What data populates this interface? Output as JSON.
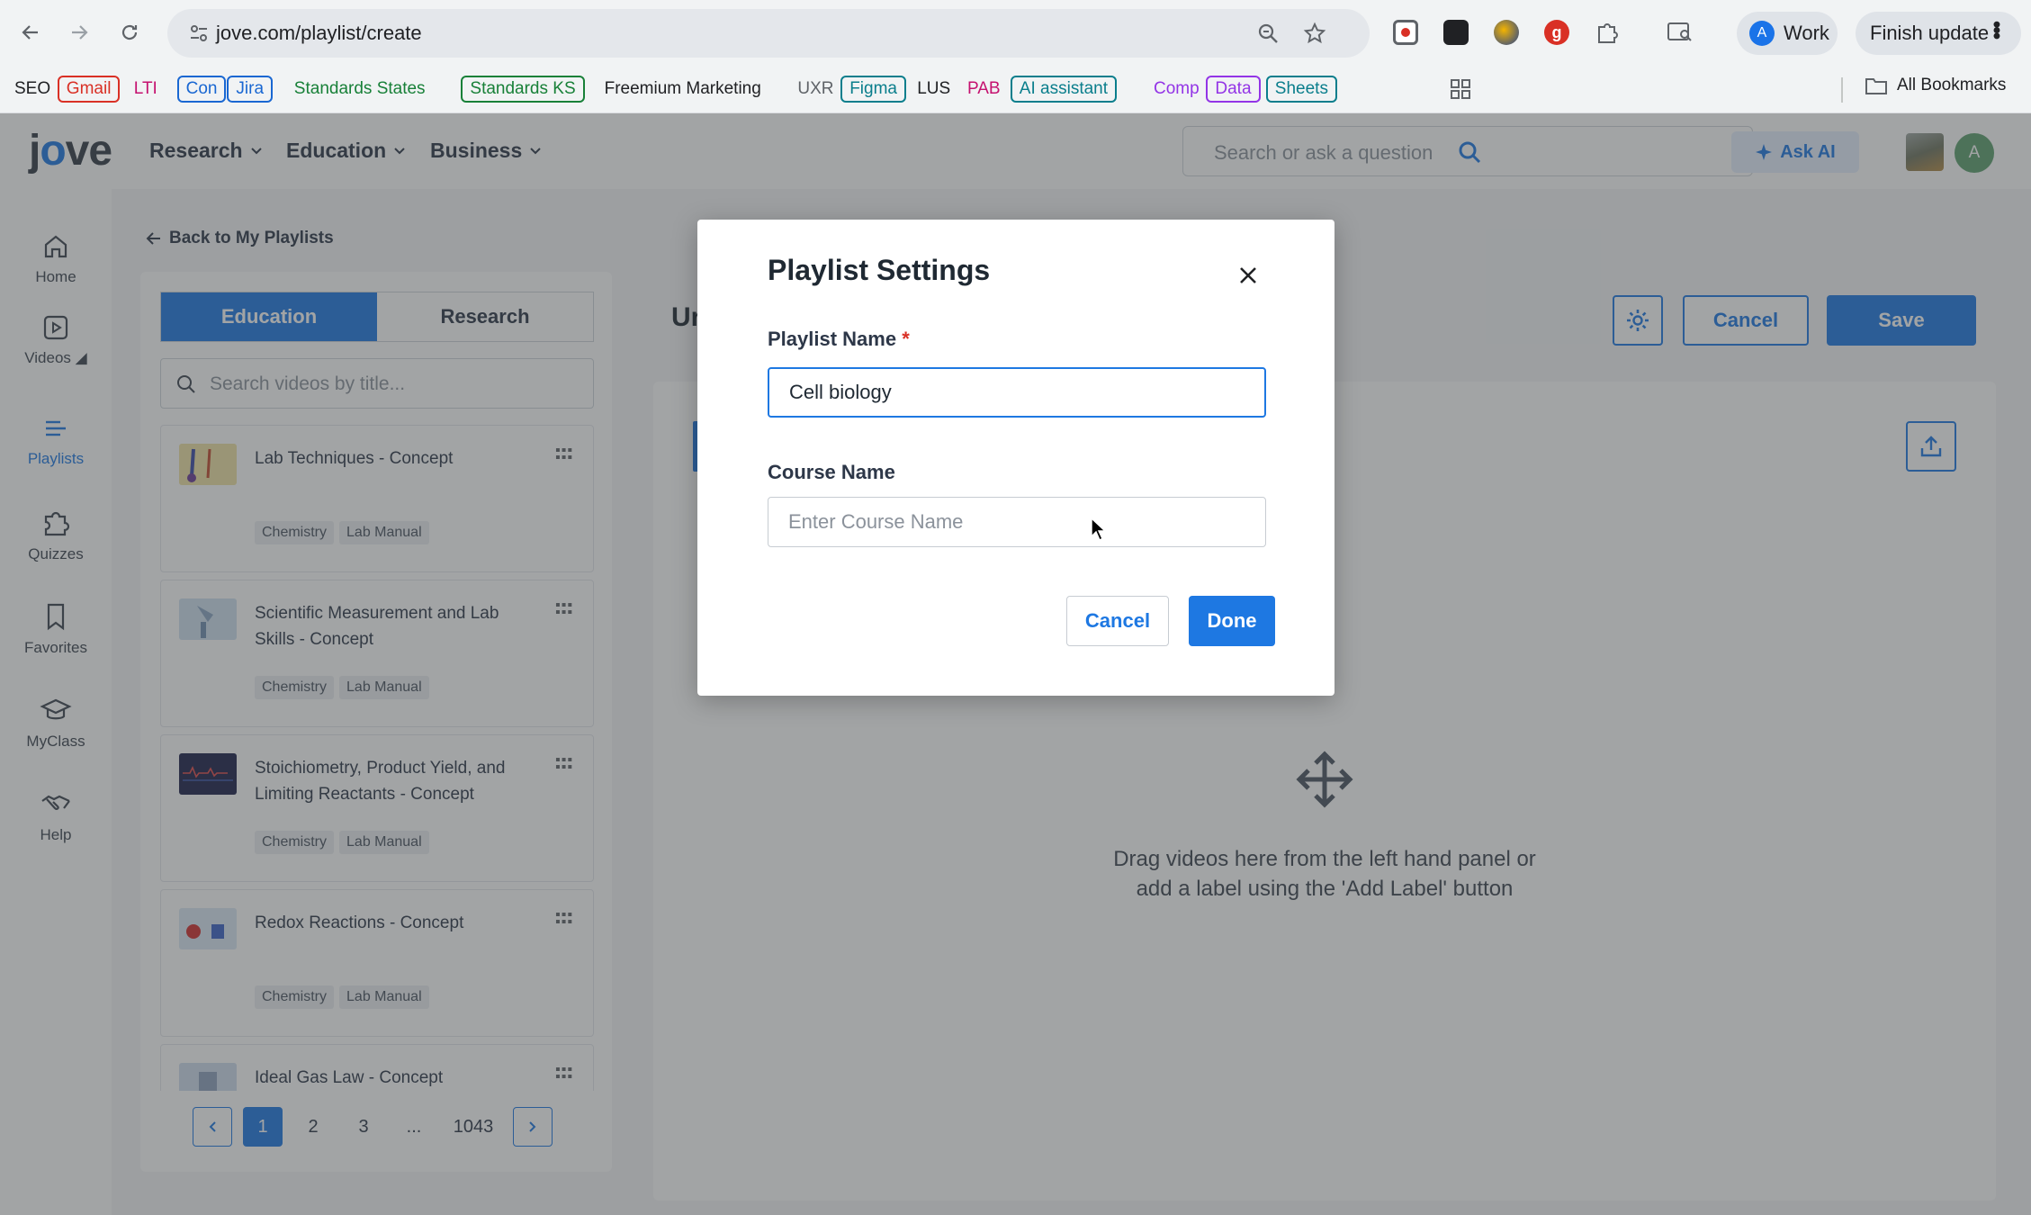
{
  "browser": {
    "url": "jove.com/playlist/create",
    "profile_label": "Work",
    "profile_initial": "A",
    "update_label": "Finish update",
    "all_bookmarks": "All Bookmarks",
    "bookmarks": [
      {
        "label": "SEO",
        "color": "#202124",
        "border": "none"
      },
      {
        "label": "Gmail",
        "color": "#d93025",
        "border": "#d93025"
      },
      {
        "label": "LTI",
        "color": "#c5116f",
        "border": "none"
      },
      {
        "label": "Con",
        "color": "#1967d2",
        "border": "#1967d2"
      },
      {
        "label": "Jira",
        "color": "#1967d2",
        "border": "#1967d2"
      },
      {
        "label": "Standards States",
        "color": "#188038",
        "border": "none"
      },
      {
        "label": "Standards KS",
        "color": "#188038",
        "border": "#188038"
      },
      {
        "label": "Freemium Marketing",
        "color": "#202124",
        "border": "none"
      },
      {
        "label": "UXR",
        "color": "#5f6368",
        "border": "none"
      },
      {
        "label": "Figma",
        "color": "#0a7e8c",
        "border": "#0a7e8c"
      },
      {
        "label": "LUS",
        "color": "#202124",
        "border": "none"
      },
      {
        "label": "PAB",
        "color": "#c5116f",
        "border": "none"
      },
      {
        "label": "AI assistant",
        "color": "#0a7e8c",
        "border": "#0a7e8c"
      },
      {
        "label": "Comp",
        "color": "#9334e6",
        "border": "none"
      },
      {
        "label": "Data",
        "color": "#9334e6",
        "border": "#9334e6"
      },
      {
        "label": "Sheets",
        "color": "#0a7e8c",
        "border": "#0a7e8c"
      }
    ]
  },
  "header": {
    "logo": "jove",
    "nav": [
      {
        "label": "Research"
      },
      {
        "label": "Education"
      },
      {
        "label": "Business"
      }
    ],
    "search_placeholder": "Search or ask a question",
    "ask_ai": "Ask AI",
    "user_initial": "A"
  },
  "sidebar": {
    "items": [
      {
        "label": "Home",
        "icon": "home-icon"
      },
      {
        "label": "Videos ◢",
        "icon": "video-icon"
      },
      {
        "label": "Playlists",
        "icon": "playlist-icon",
        "active": true
      },
      {
        "label": "Quizzes",
        "icon": "puzzle-icon"
      },
      {
        "label": "Favorites",
        "icon": "bookmark-icon"
      },
      {
        "label": "MyClass",
        "icon": "graduation-cap-icon"
      },
      {
        "label": "Help",
        "icon": "handshake-icon"
      }
    ]
  },
  "left_panel": {
    "back_label": "Back to My Playlists",
    "tabs": [
      {
        "label": "Education",
        "active": true
      },
      {
        "label": "Research",
        "active": false
      }
    ],
    "search_placeholder": "Search videos by title...",
    "videos": [
      {
        "title": "Lab Techniques - Concept",
        "tags": [
          "Chemistry",
          "Lab Manual"
        ],
        "thumb": "#efe3a6"
      },
      {
        "title": "Scientific Measurement and Lab Skills - Concept",
        "tags": [
          "Chemistry",
          "Lab Manual"
        ],
        "thumb": "#cfe0f0"
      },
      {
        "title": "Stoichiometry, Product Yield, and Limiting Reactants - Concept",
        "tags": [
          "Chemistry",
          "Lab Manual"
        ],
        "thumb": "#1c1f4a"
      },
      {
        "title": "Redox Reactions - Concept",
        "tags": [
          "Chemistry",
          "Lab Manual"
        ],
        "thumb": "#dbe8f5"
      },
      {
        "title": "Ideal Gas Law - Concept",
        "tags": [],
        "thumb": "#cfdced"
      }
    ],
    "pagination": {
      "pages": [
        "1",
        "2",
        "3",
        "...",
        "1043"
      ],
      "current": "1"
    }
  },
  "main": {
    "title_partial": "Ur",
    "cancel": "Cancel",
    "save": "Save",
    "drop_text_line1": "Drag videos here from the left hand panel or",
    "drop_text_line2": "add a label using the 'Add Label' button"
  },
  "modal": {
    "title": "Playlist Settings",
    "playlist_name_label": "Playlist Name",
    "required_mark": "*",
    "playlist_name_value": "Cell biology",
    "course_name_label": "Course Name",
    "course_name_placeholder": "Enter Course Name",
    "cancel": "Cancel",
    "done": "Done"
  },
  "colors": {
    "accent": "#1e78e2",
    "required": "#d93025"
  }
}
